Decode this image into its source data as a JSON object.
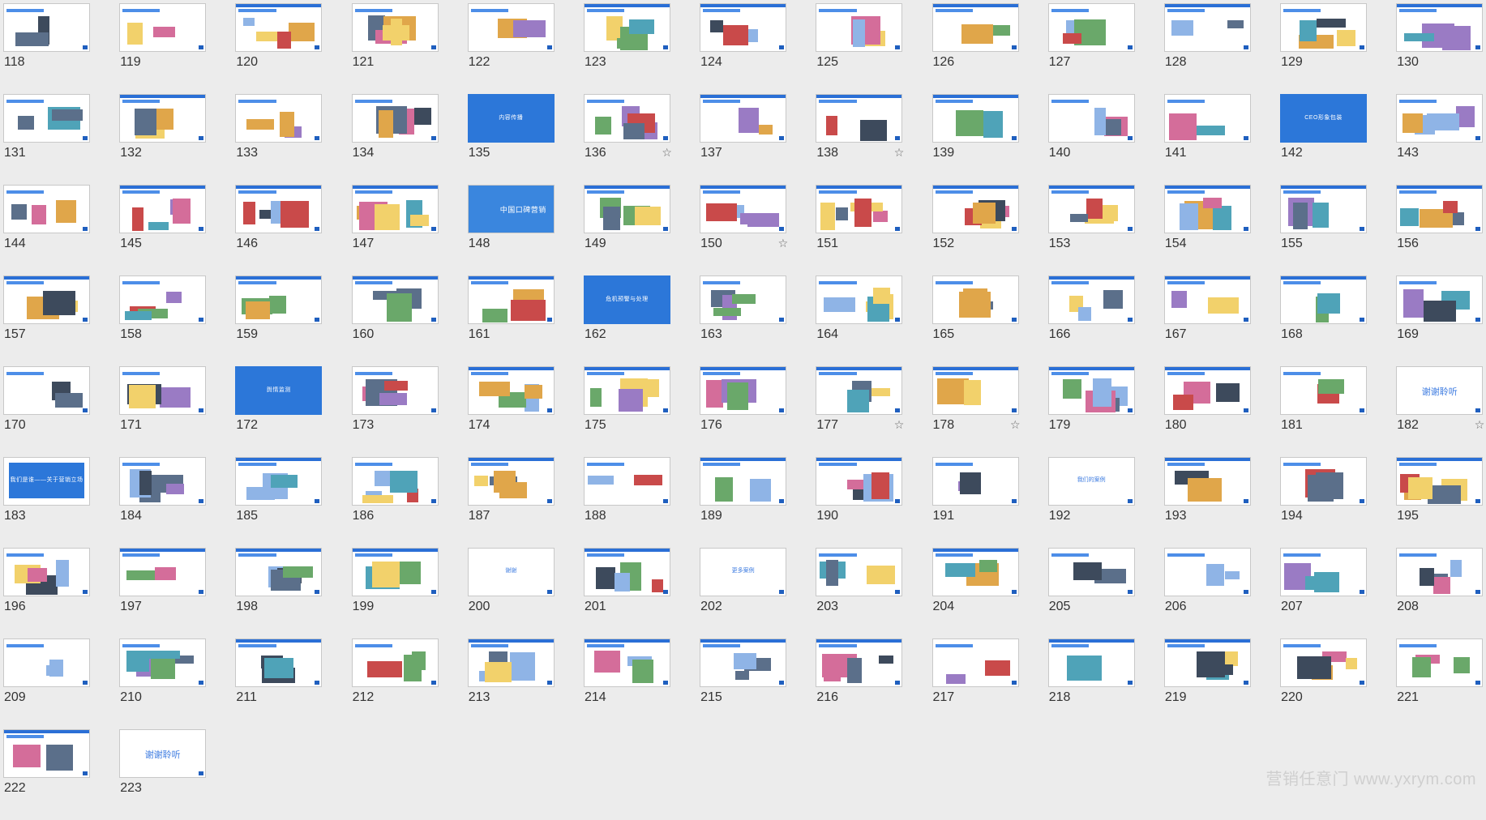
{
  "grid": {
    "first_slide": 118,
    "last_slide": 223
  },
  "starred": [
    136,
    138,
    150,
    177,
    178,
    182
  ],
  "colors": {
    "accent": "#2a6fd6",
    "solid_blue": "#2c77d9",
    "dark": "#222a33"
  },
  "slides": {
    "135": {
      "style": "solid-blue",
      "caption": "内容传播"
    },
    "142": {
      "style": "solid-blue",
      "caption": "CEO形象包装"
    },
    "162": {
      "style": "solid-blue",
      "caption": "危机预警与处理"
    },
    "172": {
      "style": "solid-blue",
      "caption": "舆情监测"
    },
    "182": {
      "style": "thanks",
      "caption": "谢谢聆听"
    },
    "183": {
      "style": "solid-blue-box",
      "caption": "我们是谁——关于营销立场"
    },
    "223": {
      "style": "thanks",
      "caption": "谢谢聆听"
    },
    "148": {
      "style": "hero",
      "caption": "中国口碑营销"
    },
    "200": {
      "style": "center-label",
      "caption": "谢谢"
    },
    "202": {
      "style": "center-label",
      "caption": "更多案例"
    },
    "192": {
      "style": "center-label",
      "caption": "我们的案例"
    }
  },
  "watermark": "营销任意门 www.yxrym.com"
}
